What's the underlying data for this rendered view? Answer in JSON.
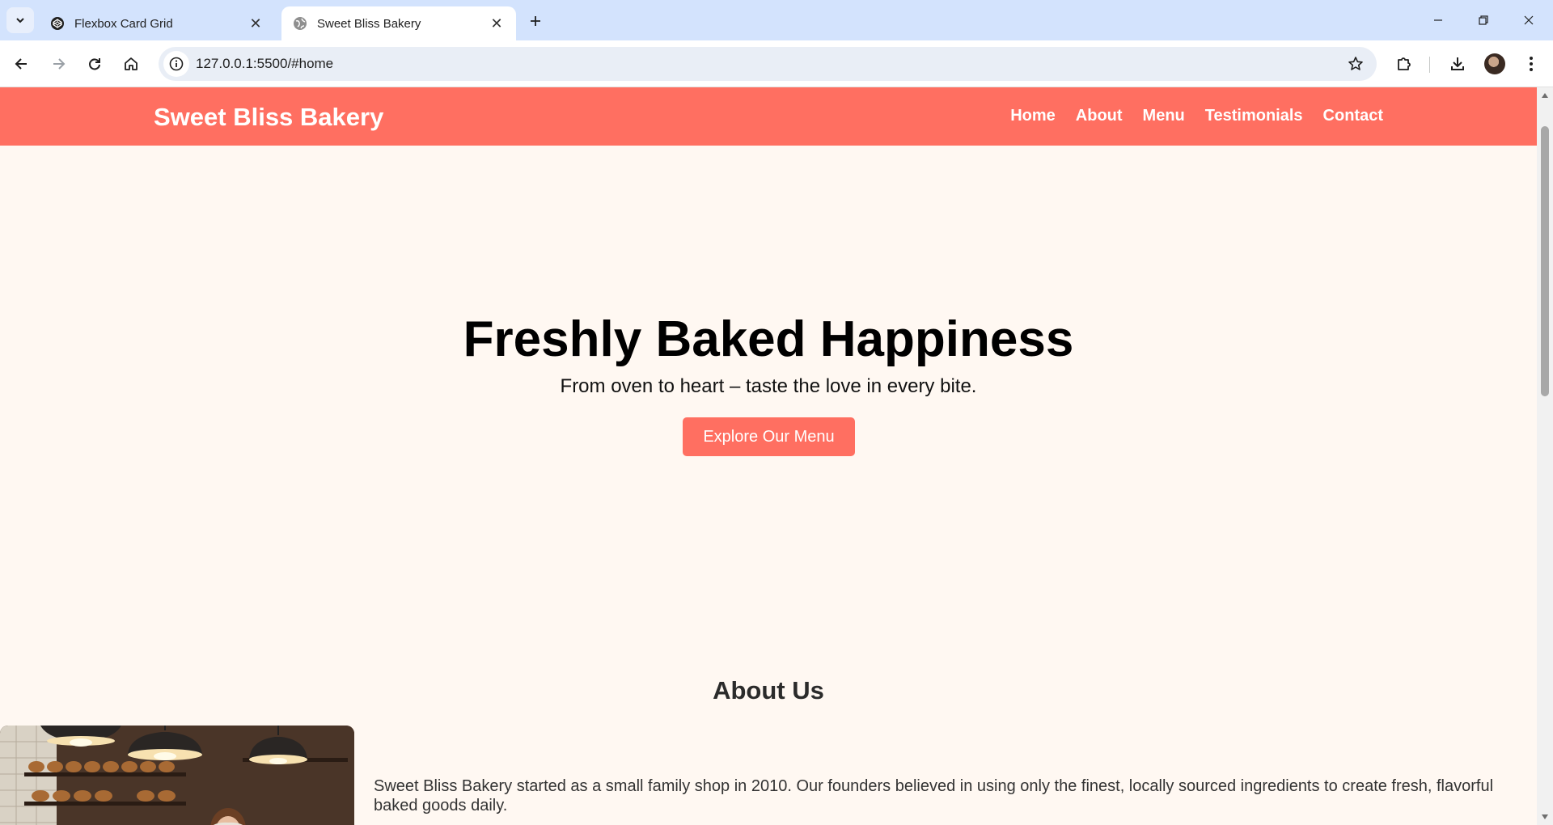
{
  "browser": {
    "tabs": [
      {
        "title": "Flexbox Card Grid",
        "icon": "codepen-icon",
        "active": false
      },
      {
        "title": "Sweet Bliss Bakery",
        "icon": "globe-icon",
        "active": true
      }
    ],
    "url": "127.0.0.1:5500/#home"
  },
  "site": {
    "brand": "Sweet Bliss Bakery",
    "nav": [
      "Home",
      "About",
      "Menu",
      "Testimonials",
      "Contact"
    ],
    "accent_color": "#ff6f61",
    "background_color": "#fff8f2"
  },
  "hero": {
    "title": "Freshly Baked Happiness",
    "subtitle": "From oven to heart – taste the love in every bite.",
    "button_label": "Explore Our Menu"
  },
  "about": {
    "title": "About Us",
    "text": "Sweet Bliss Bakery started as a small family shop in 2010. Our founders believed in using only the finest, locally sourced ingredients to create fresh, flavorful baked goods daily."
  }
}
